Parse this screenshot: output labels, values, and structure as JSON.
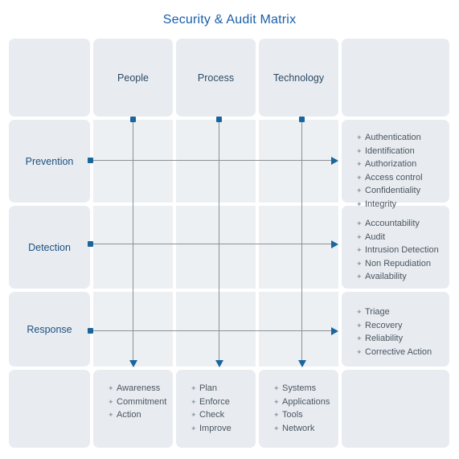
{
  "title": "Security & Audit Matrix",
  "colors": {
    "title": "#1a5fa8",
    "cell_bg": "#e8ecf1",
    "header_text": "#2c4a63",
    "row_label_text": "#1d5180",
    "list_text": "#4b5560",
    "connector_line": "#8c9094",
    "marker": "#19669e"
  },
  "columns": [
    {
      "label": "People"
    },
    {
      "label": "Process"
    },
    {
      "label": "Technology"
    }
  ],
  "rows": [
    {
      "label": "Prevention"
    },
    {
      "label": "Detection"
    },
    {
      "label": "Response"
    }
  ],
  "row_outcomes": [
    {
      "row": "Prevention",
      "items": [
        "Authentication",
        "Identification",
        "Authorization",
        "Access control",
        "Confidentiality",
        "Integrity"
      ]
    },
    {
      "row": "Detection",
      "items": [
        "Accountability",
        "Audit",
        "Intrusion Detection",
        "Non Repudiation",
        "Availability"
      ]
    },
    {
      "row": "Response",
      "items": [
        "Triage",
        "Recovery",
        "Reliability",
        "Corrective Action"
      ]
    }
  ],
  "column_outcomes": [
    {
      "column": "People",
      "items": [
        "Awareness",
        "Commitment",
        "Action"
      ]
    },
    {
      "column": "Process",
      "items": [
        "Plan",
        "Enforce",
        "Check",
        "Improve"
      ]
    },
    {
      "column": "Technology",
      "items": [
        "Systems",
        "Applications",
        "Tools",
        "Network"
      ]
    }
  ],
  "bullet_glyph": "✦"
}
